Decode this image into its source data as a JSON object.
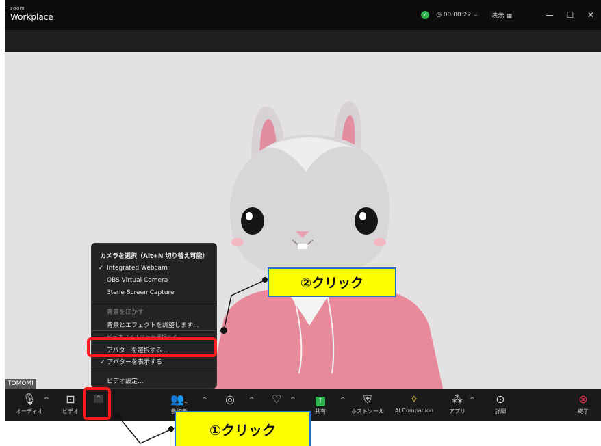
{
  "titlebar": {
    "logo_small": "zoom",
    "logo_big": "Workplace",
    "timer": "◷ 00:00:22 ⌄",
    "view_label": "表示 ▦",
    "minimize": "—",
    "maximize": "☐",
    "close": "✕"
  },
  "video": {
    "name_tag": "TOMOMI"
  },
  "toolbar": {
    "audio": "オーディオ",
    "video": "ビデオ",
    "participants": "参加者",
    "participants_count": "1",
    "share": "共有",
    "host_tools": "ホストツール",
    "ai_companion": "AI Companion",
    "apps": "アプリ",
    "more": "詳細",
    "end": "終了"
  },
  "menu": {
    "header": "カメラを選択（Alt+N 切り替え可能）",
    "cameras": [
      "Integrated Webcam",
      "OBS Virtual Camera",
      "3tene Screen Capture"
    ],
    "checked": "✓",
    "blur": "背景をぼかす",
    "adjust": "背景とエフェクトを調整します...",
    "hidden_row": "ビデオフィルターを選択する...",
    "avatar": "アバターを選択する...",
    "show_avatar": "アバターを表示する",
    "settings": "ビデオ設定..."
  },
  "annotations": {
    "step1": "①クリック",
    "step2": "②クリック"
  },
  "colors": {
    "highlight_red": "#ff1a1a",
    "callout_yellow": "#ffff00",
    "callout_border": "#1e6fd0",
    "share_green": "#2bb24c",
    "end_red": "#e8334a"
  }
}
